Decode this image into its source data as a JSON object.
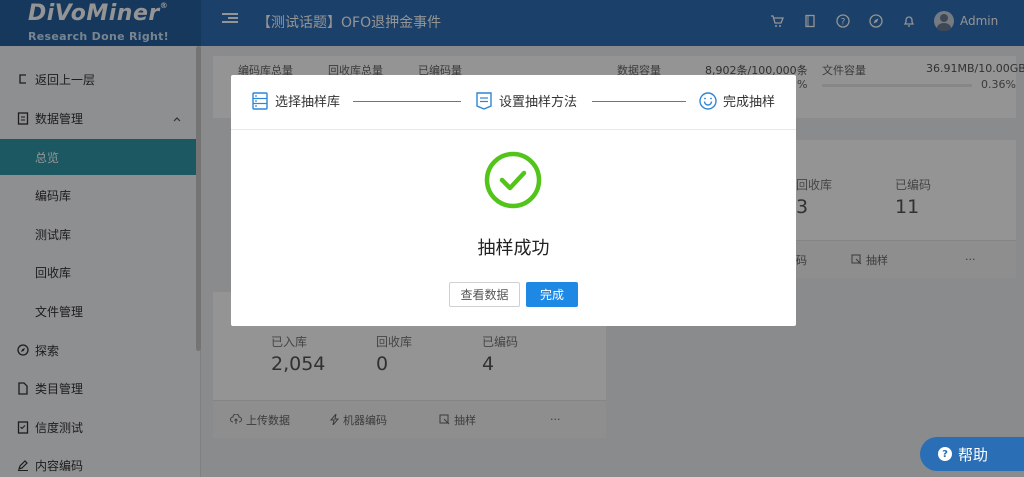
{
  "header": {
    "logo_brand": "DiVoMiner",
    "logo_tagline": "Research Done Right!",
    "page_title": "【测试话题】OFO退押金事件",
    "user_name": "Admin"
  },
  "sidebar": {
    "items": [
      {
        "label": "返回上一层"
      },
      {
        "label": "数据管理"
      },
      {
        "label": "总览"
      },
      {
        "label": "编码库"
      },
      {
        "label": "测试库"
      },
      {
        "label": "回收库"
      },
      {
        "label": "文件管理"
      },
      {
        "label": "探索"
      },
      {
        "label": "类目管理"
      },
      {
        "label": "信度测试"
      },
      {
        "label": "内容编码"
      }
    ]
  },
  "stats": {
    "coded_total": "编码库总量",
    "recycle_total": "回收库总量",
    "coded": "已编码量",
    "data_capacity": "数据容量",
    "data_capacity_value": "8,902条/100,000条",
    "data_capacity_pct": "%",
    "file_capacity": "文件容量",
    "file_capacity_value": "36.91MB/10.00GB",
    "file_capacity_pct": "0.36%"
  },
  "card_right": {
    "recycle_label": "回收库",
    "recycle_value": "3",
    "coded_label": "已编码",
    "coded_value": "11",
    "footer_left": "码",
    "footer_sample": "抽样",
    "footer_more": "···"
  },
  "card_left": {
    "in_label": "已入库",
    "in_value": "2,054",
    "recycle_label": "回收库",
    "recycle_value": "0",
    "coded_label": "已编码",
    "coded_value": "4",
    "footer_upload": "上传数据",
    "footer_machine": "机器编码",
    "footer_sample": "抽样",
    "footer_more": "···"
  },
  "modal": {
    "step1": "选择抽样库",
    "step2": "设置抽样方法",
    "step3": "完成抽样",
    "success_text": "抽样成功",
    "view_data_button": "查看数据",
    "done_button": "完成"
  },
  "help": {
    "label": "帮助"
  },
  "colors": {
    "header": "#2f6fb6",
    "accent": "#1e88e5",
    "active_sidebar": "#2f98a8",
    "success": "#52c41a"
  }
}
